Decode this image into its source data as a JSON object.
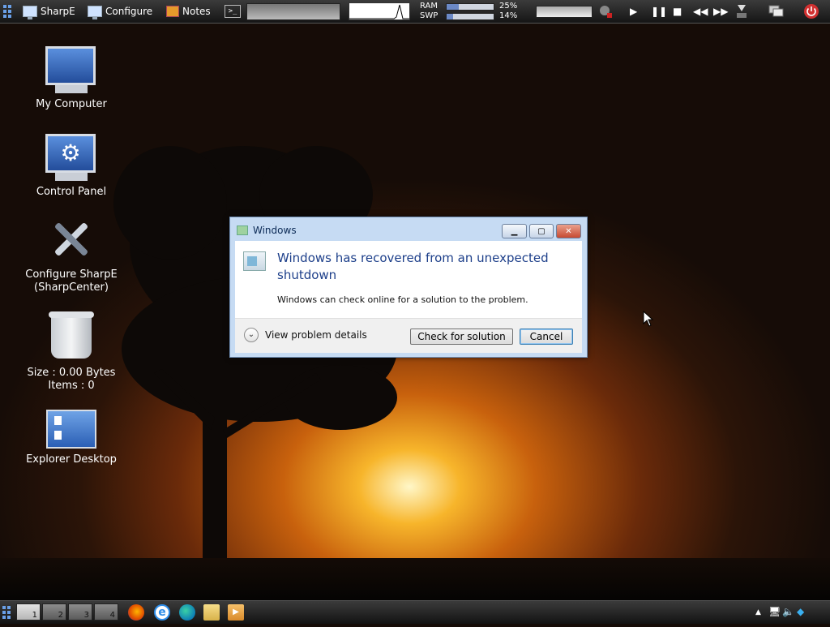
{
  "topbar": {
    "sharpe_label": "SharpE",
    "configure_label": "Configure",
    "notes_label": "Notes",
    "terminal_glyph": ">_",
    "ram_label": "RAM",
    "swp_label": "SWP",
    "ram_percent": "25%",
    "swp_percent": "14%",
    "ram_fraction": 0.25,
    "swp_fraction": 0.14
  },
  "desktop_icons": [
    {
      "label": "My Computer"
    },
    {
      "label": "Control Panel"
    },
    {
      "label_line1": "Configure SharpE",
      "label_line2": "(SharpCenter)"
    },
    {
      "label_line1": "Size : 0.00 Bytes",
      "label_line2": "Items : 0"
    },
    {
      "label": "Explorer Desktop"
    }
  ],
  "dialog": {
    "title": "Windows",
    "heading": "Windows has recovered from an unexpected shutdown",
    "message": "Windows can check online for a solution to the problem.",
    "details_label": "View problem details",
    "check_button": "Check for solution",
    "cancel_button": "Cancel"
  },
  "bottombar": {
    "workspaces": [
      "1",
      "2",
      "3",
      "4"
    ],
    "active_workspace": "1"
  },
  "colors": {
    "accent_blue": "#1d3f8a",
    "bar_fill": "#6b89c6",
    "close_red": "#c74a32",
    "power_red": "#d13030"
  },
  "icons": [
    "grid-icon",
    "monitor-icon",
    "notes-icon",
    "terminal-icon",
    "media-play-icon",
    "media-pause-icon",
    "media-stop-icon",
    "media-prev-icon",
    "media-next-icon",
    "power-icon",
    "firefox-icon",
    "ie-icon",
    "edge-icon",
    "folder-icon",
    "media-player-icon",
    "volume-muted-icon",
    "network-icon"
  ]
}
